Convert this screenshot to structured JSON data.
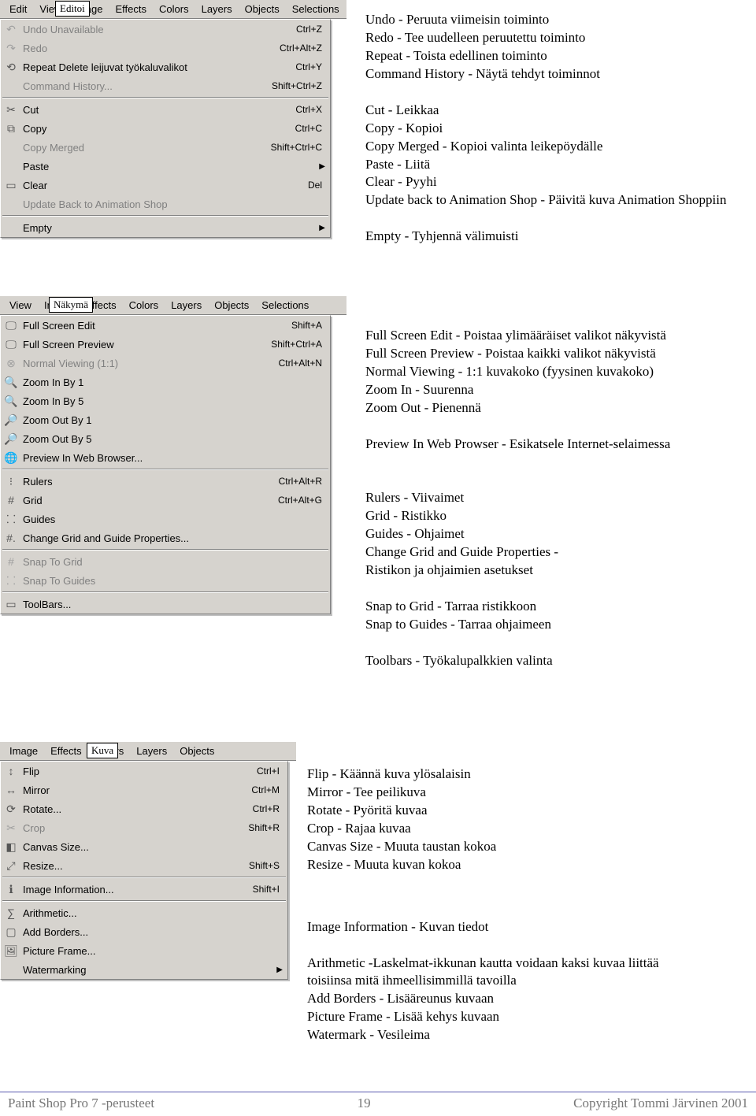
{
  "tags": {
    "edit": "Editoi",
    "view": "Näkymä",
    "image": "Kuva"
  },
  "menubars": {
    "edit": [
      "Edit",
      "View",
      "Image",
      "Effects",
      "Colors",
      "Layers",
      "Objects",
      "Selections"
    ],
    "view": [
      "View",
      "Image",
      "Effects",
      "Colors",
      "Layers",
      "Objects",
      "Selections"
    ],
    "image": [
      "Image",
      "Effects",
      "Colors",
      "Layers",
      "Objects"
    ]
  },
  "editMenu": [
    {
      "icon": "↶",
      "label": "Undo Unavailable",
      "shortcut": "Ctrl+Z",
      "disabled": true
    },
    {
      "icon": "↷",
      "label": "Redo",
      "shortcut": "Ctrl+Alt+Z",
      "disabled": true
    },
    {
      "icon": "⟲",
      "label": "Repeat Delete leijuvat työkaluvalikot",
      "shortcut": "Ctrl+Y"
    },
    {
      "icon": "",
      "label": "Command History...",
      "shortcut": "Shift+Ctrl+Z",
      "disabled": true
    },
    {
      "sep": true
    },
    {
      "icon": "✂",
      "label": "Cut",
      "shortcut": "Ctrl+X"
    },
    {
      "icon": "⧉",
      "label": "Copy",
      "shortcut": "Ctrl+C"
    },
    {
      "icon": "",
      "label": "Copy Merged",
      "shortcut": "Shift+Ctrl+C",
      "disabled": true
    },
    {
      "icon": "",
      "label": "Paste",
      "submenu": true
    },
    {
      "icon": "▭",
      "label": "Clear",
      "shortcut": "Del"
    },
    {
      "icon": "",
      "label": "Update Back to Animation Shop",
      "disabled": true
    },
    {
      "sep": true
    },
    {
      "icon": "",
      "label": "Empty",
      "submenu": true
    }
  ],
  "viewMenu": [
    {
      "icon": "🖵",
      "label": "Full Screen Edit",
      "shortcut": "Shift+A"
    },
    {
      "icon": "🖵",
      "label": "Full Screen Preview",
      "shortcut": "Shift+Ctrl+A"
    },
    {
      "icon": "⊗",
      "label": "Normal Viewing (1:1)",
      "shortcut": "Ctrl+Alt+N",
      "disabled": true
    },
    {
      "icon": "🔍",
      "label": "Zoom In By 1"
    },
    {
      "icon": "🔍",
      "label": "Zoom In By 5"
    },
    {
      "icon": "🔎",
      "label": "Zoom Out By 1"
    },
    {
      "icon": "🔎",
      "label": "Zoom Out By 5"
    },
    {
      "icon": "🌐",
      "label": "Preview In Web Browser..."
    },
    {
      "sep": true
    },
    {
      "icon": "⁝",
      "label": "Rulers",
      "shortcut": "Ctrl+Alt+R"
    },
    {
      "icon": "#",
      "label": "Grid",
      "shortcut": "Ctrl+Alt+G"
    },
    {
      "icon": "⸬",
      "label": "Guides"
    },
    {
      "icon": "#.",
      "label": "Change Grid and Guide Properties..."
    },
    {
      "sep": true
    },
    {
      "icon": "#",
      "label": "Snap To Grid",
      "disabled": true
    },
    {
      "icon": "⸬",
      "label": "Snap To Guides",
      "disabled": true
    },
    {
      "sep": true
    },
    {
      "icon": "▭",
      "label": "ToolBars..."
    }
  ],
  "imageMenu": [
    {
      "icon": "↕",
      "label": "Flip",
      "shortcut": "Ctrl+I"
    },
    {
      "icon": "↔",
      "label": "Mirror",
      "shortcut": "Ctrl+M"
    },
    {
      "icon": "⟳",
      "label": "Rotate...",
      "shortcut": "Ctrl+R"
    },
    {
      "icon": "✂",
      "label": "Crop",
      "shortcut": "Shift+R",
      "disabled": true
    },
    {
      "icon": "◧",
      "label": "Canvas Size..."
    },
    {
      "icon": "⤢",
      "label": "Resize...",
      "shortcut": "Shift+S"
    },
    {
      "sep": true
    },
    {
      "icon": "ℹ",
      "label": "Image Information...",
      "shortcut": "Shift+I"
    },
    {
      "sep": true
    },
    {
      "icon": "∑",
      "label": "Arithmetic..."
    },
    {
      "icon": "▢",
      "label": "Add Borders..."
    },
    {
      "icon": "🖼",
      "label": "Picture Frame..."
    },
    {
      "icon": "",
      "label": "Watermarking",
      "submenu": true
    }
  ],
  "descEdit": [
    "Undo - Peruuta viimeisin toiminto",
    "Redo - Tee uudelleen peruutettu toiminto",
    "Repeat - Toista edellinen toiminto",
    "Command History - Näytä tehdyt toiminnot",
    "",
    "Cut - Leikkaa",
    "Copy - Kopioi",
    "Copy Merged - Kopioi valinta leikepöydälle",
    "Paste - Liitä",
    "Clear - Pyyhi",
    "Update back to Animation Shop - Päivitä kuva Animation Shoppiin",
    "",
    "Empty - Tyhjennä välimuisti"
  ],
  "descView": [
    "Full Screen Edit - Poistaa ylimääräiset valikot näkyvistä",
    "Full Screen Preview - Poistaa kaikki valikot näkyvistä",
    "Normal Viewing - 1:1 kuvakoko (fyysinen kuvakoko)",
    "Zoom In - Suurenna",
    "Zoom Out - Pienennä",
    "",
    "Preview In Web Prowser - Esikatsele Internet-selaimessa",
    "",
    "",
    "Rulers - Viivaimet",
    "Grid - Ristikko",
    "Guides - Ohjaimet",
    "Change Grid and Guide Properties -",
    "Ristikon ja ohjaimien asetukset",
    "",
    "Snap to Grid - Tarraa ristikkoon",
    "Snap to Guides - Tarraa ohjaimeen",
    "",
    "Toolbars - Työkalupalkkien valinta"
  ],
  "descImage1": [
    "Flip - Käännä kuva ylösalaisin",
    "Mirror - Tee peilikuva",
    "Rotate - Pyöritä kuvaa",
    "Crop - Rajaa kuvaa",
    "Canvas Size - Muuta taustan kokoa",
    "Resize - Muuta kuvan kokoa"
  ],
  "descImage2": [
    "Image Information - Kuvan tiedot",
    "",
    "Arithmetic -Laskelmat-ikkunan kautta voidaan kaksi kuvaa liittää",
    "               toisiinsa mitä ihmeellisimmillä tavoilla",
    "Add Borders - Lisääreunus kuvaan",
    "Picture Frame - Lisää kehys kuvaan",
    "Watermark - Vesileima"
  ],
  "footer": {
    "left": "Paint Shop Pro 7 -perusteet",
    "mid": "19",
    "right": "Copyright Tommi Järvinen 2001"
  }
}
